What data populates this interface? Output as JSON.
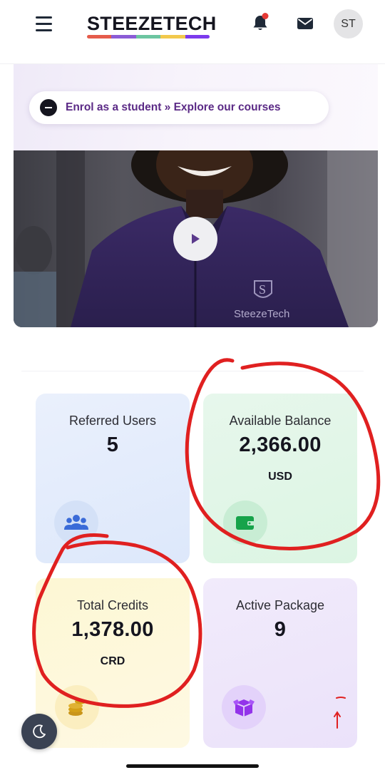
{
  "header": {
    "logo_text": "STEEZETECH",
    "logo_colors": [
      "#e55c4b",
      "#8b5cd6",
      "#6cc5a0",
      "#f2c94c",
      "#7c3aed"
    ],
    "avatar_initials": "ST",
    "notification_dot_color": "#e53935",
    "icons": [
      "menu-icon",
      "bell-icon",
      "mail-icon"
    ]
  },
  "hero": {
    "enrol_text": "Enrol as a student » Explore our courses",
    "video_watermark": "SteezeTech",
    "play_icon": "play-icon"
  },
  "cards": {
    "referred": {
      "label": "Referred Users",
      "value": "5",
      "icon": "users-icon",
      "accent": "#3a6bd8"
    },
    "balance": {
      "label": "Available Balance",
      "value": "2,366.00",
      "unit": "USD",
      "icon": "wallet-icon",
      "accent": "#16a34a"
    },
    "credits": {
      "label": "Total Credits",
      "value": "1,378.00",
      "unit": "CRD",
      "icon": "coins-icon",
      "accent": "#d4a017"
    },
    "package": {
      "label": "Active Package",
      "value": "9",
      "icon": "package-icon",
      "accent": "#9333ea"
    }
  },
  "controls": {
    "theme_icon": "moon-icon"
  },
  "annotation_color": "#e02020"
}
